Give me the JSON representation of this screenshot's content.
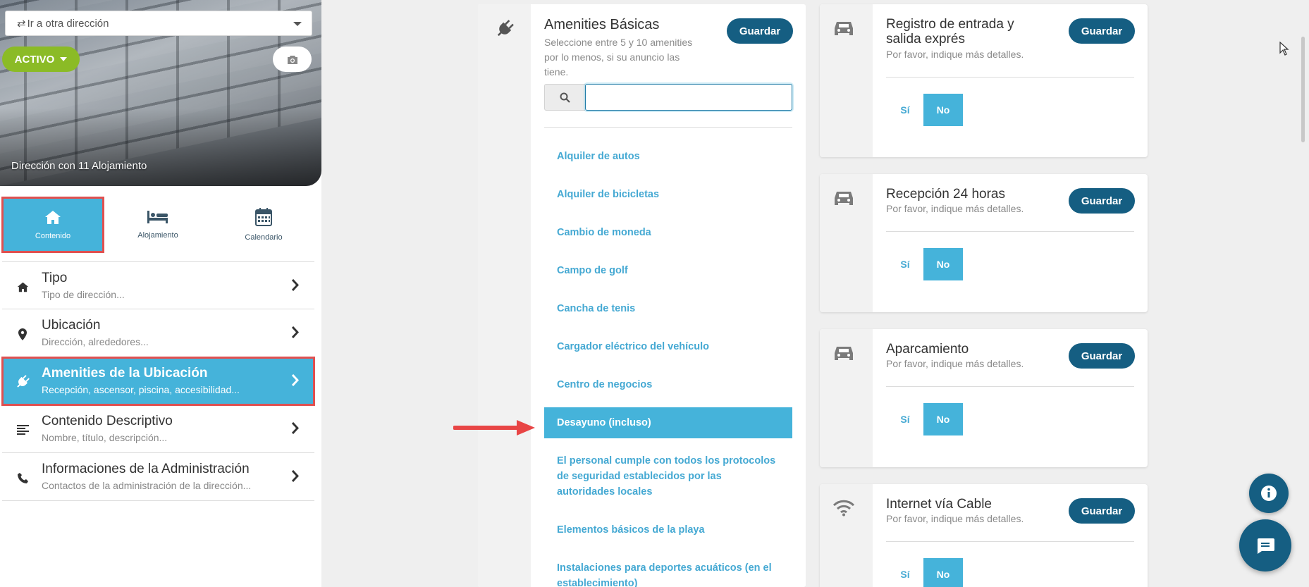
{
  "sidebar": {
    "address_select": {
      "value": "Ir a otra dirección",
      "icon": "swap-icon"
    },
    "status": {
      "label": "ACTIVO"
    },
    "hero_caption": "Dirección con 11 Alojamiento",
    "tabs": [
      {
        "label": "Contenido",
        "icon": "home-icon",
        "active": true
      },
      {
        "label": "Alojamiento",
        "icon": "bed-icon",
        "active": false
      },
      {
        "label": "Calendario",
        "icon": "calendar-icon",
        "active": false
      }
    ],
    "menu": [
      {
        "title": "Tipo",
        "subtitle": "Tipo de dirección...",
        "icon": "home-icon"
      },
      {
        "title": "Ubicación",
        "subtitle": "Dirección, alrededores...",
        "icon": "map-marker-icon"
      },
      {
        "title": "Amenities de la Ubicación",
        "subtitle": "Recepción, ascensor, piscina, accesibilidad...",
        "icon": "plug-icon",
        "active": true
      },
      {
        "title": "Contenido Descriptivo",
        "subtitle": "Nombre, título, descripción...",
        "icon": "align-left-icon"
      },
      {
        "title": "Informaciones de la Administración",
        "subtitle": "Contactos de la administración de la dirección...",
        "icon": "phone-icon"
      }
    ]
  },
  "amenities": {
    "title": "Amenities Básicas",
    "description": "Seleccione entre 5 y 10 amenities por lo menos, si su anuncio las tiene.",
    "save_label": "Guardar",
    "search": {
      "value": "",
      "placeholder": ""
    },
    "items": [
      "Alquiler de autos",
      "Alquiler de bicicletas",
      "Cambio de moneda",
      "Campo de golf",
      "Cancha de tenis",
      "Cargador eléctrico del vehículo",
      "Centro de negocios",
      "Desayuno (incluso)",
      "El personal cumple con todos los protocolos de seguridad establecidos por las autoridades locales",
      "Elementos básicos de la playa",
      "Instalaciones para deportes acuáticos (en el establecimiento)"
    ],
    "selected_item": "Desayuno (incluso)"
  },
  "cards": [
    {
      "title": "Registro de entrada y salida exprés",
      "subtitle": "Por favor, indique más detalles.",
      "icon": "car-icon",
      "save_label": "Guardar",
      "yes_label": "Sí",
      "no_label": "No",
      "selected": "No"
    },
    {
      "title": "Recepción 24 horas",
      "subtitle": "Por favor, indique más detalles.",
      "icon": "car-icon",
      "save_label": "Guardar",
      "yes_label": "Sí",
      "no_label": "No",
      "selected": "No"
    },
    {
      "title": "Aparcamiento",
      "subtitle": "Por favor, indique más detalles.",
      "icon": "car-icon",
      "save_label": "Guardar",
      "yes_label": "Sí",
      "no_label": "No",
      "selected": "No"
    },
    {
      "title": "Internet vía Cable",
      "subtitle": "Por favor, indique más detalles.",
      "icon": "wifi-icon",
      "save_label": "Guardar",
      "yes_label": "Sí",
      "no_label": "No",
      "selected": "No"
    }
  ],
  "floating": {
    "info_icon": "info-icon",
    "chat_icon": "chat-icon"
  },
  "colors": {
    "accent": "#45b3da",
    "primary_dark": "#155e82",
    "active_green": "#8bbb26",
    "highlight_red": "#e05050"
  }
}
